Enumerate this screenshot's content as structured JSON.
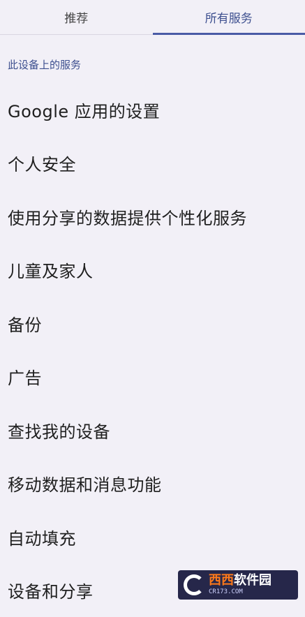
{
  "tabs": [
    {
      "label": "推荐",
      "active": false
    },
    {
      "label": "所有服务",
      "active": true
    }
  ],
  "section": {
    "header": "此设备上的服务"
  },
  "items": [
    {
      "label": "Google 应用的设置"
    },
    {
      "label": "个人安全"
    },
    {
      "label": "使用分享的数据提供个性化服务"
    },
    {
      "label": "儿童及家人"
    },
    {
      "label": "备份"
    },
    {
      "label": "广告"
    },
    {
      "label": "查找我的设备"
    },
    {
      "label": "移动数据和消息功能"
    },
    {
      "label": "自动填充"
    },
    {
      "label": "设备和分享"
    }
  ],
  "watermark": {
    "main_accent": "西西",
    "main_text": "软件园",
    "sub": "CR173.COM"
  },
  "colors": {
    "accent": "#4a5ba6",
    "background": "#f2f0f7"
  }
}
